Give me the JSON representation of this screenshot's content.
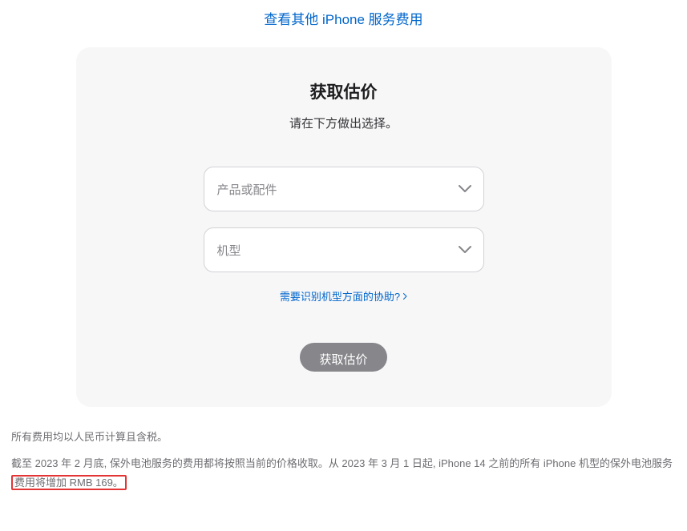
{
  "header": {
    "link_text": "查看其他 iPhone 服务费用"
  },
  "card": {
    "title": "获取估价",
    "subtitle": "请在下方做出选择。",
    "select1_placeholder": "产品或配件",
    "select2_placeholder": "机型",
    "help_text": "需要识别机型方面的协助?",
    "button_label": "获取估价"
  },
  "footer": {
    "line1": "所有费用均以人民币计算且含税。",
    "line2_part1": "截至 2023 年 2 月底, 保外电池服务的费用都将按照当前的价格收取。从 2023 年 3 月 1 日起, iPhone 14 之前的所有 iPhone 机型的保外电池服务",
    "line2_highlight": "费用将增加 RMB 169。"
  }
}
